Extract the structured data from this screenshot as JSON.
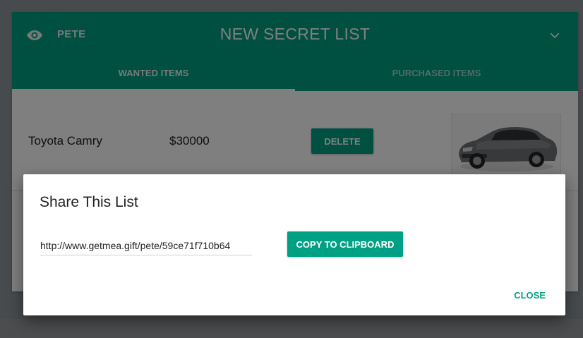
{
  "header": {
    "user_name": "PETE",
    "list_title": "NEW SECRET LIST",
    "icons": [
      "eye-icon",
      "chevron-down-icon"
    ]
  },
  "tabs": [
    {
      "label": "WANTED ITEMS",
      "active": true
    },
    {
      "label": "PURCHASED ITEMS",
      "active": false
    }
  ],
  "items": [
    {
      "name": "Toyota Camry",
      "price": "$30000",
      "delete_label": "DELETE",
      "image": "car-image"
    }
  ],
  "dialog": {
    "title": "Share This List",
    "share_url": "http://www.getmea.gift/pete/59ce71f710b64",
    "copy_label": "COPY TO CLIPBOARD",
    "close_label": "CLOSE"
  },
  "colors": {
    "accent": "#00a085",
    "overlay": "rgba(0,0,0,0.5)"
  }
}
